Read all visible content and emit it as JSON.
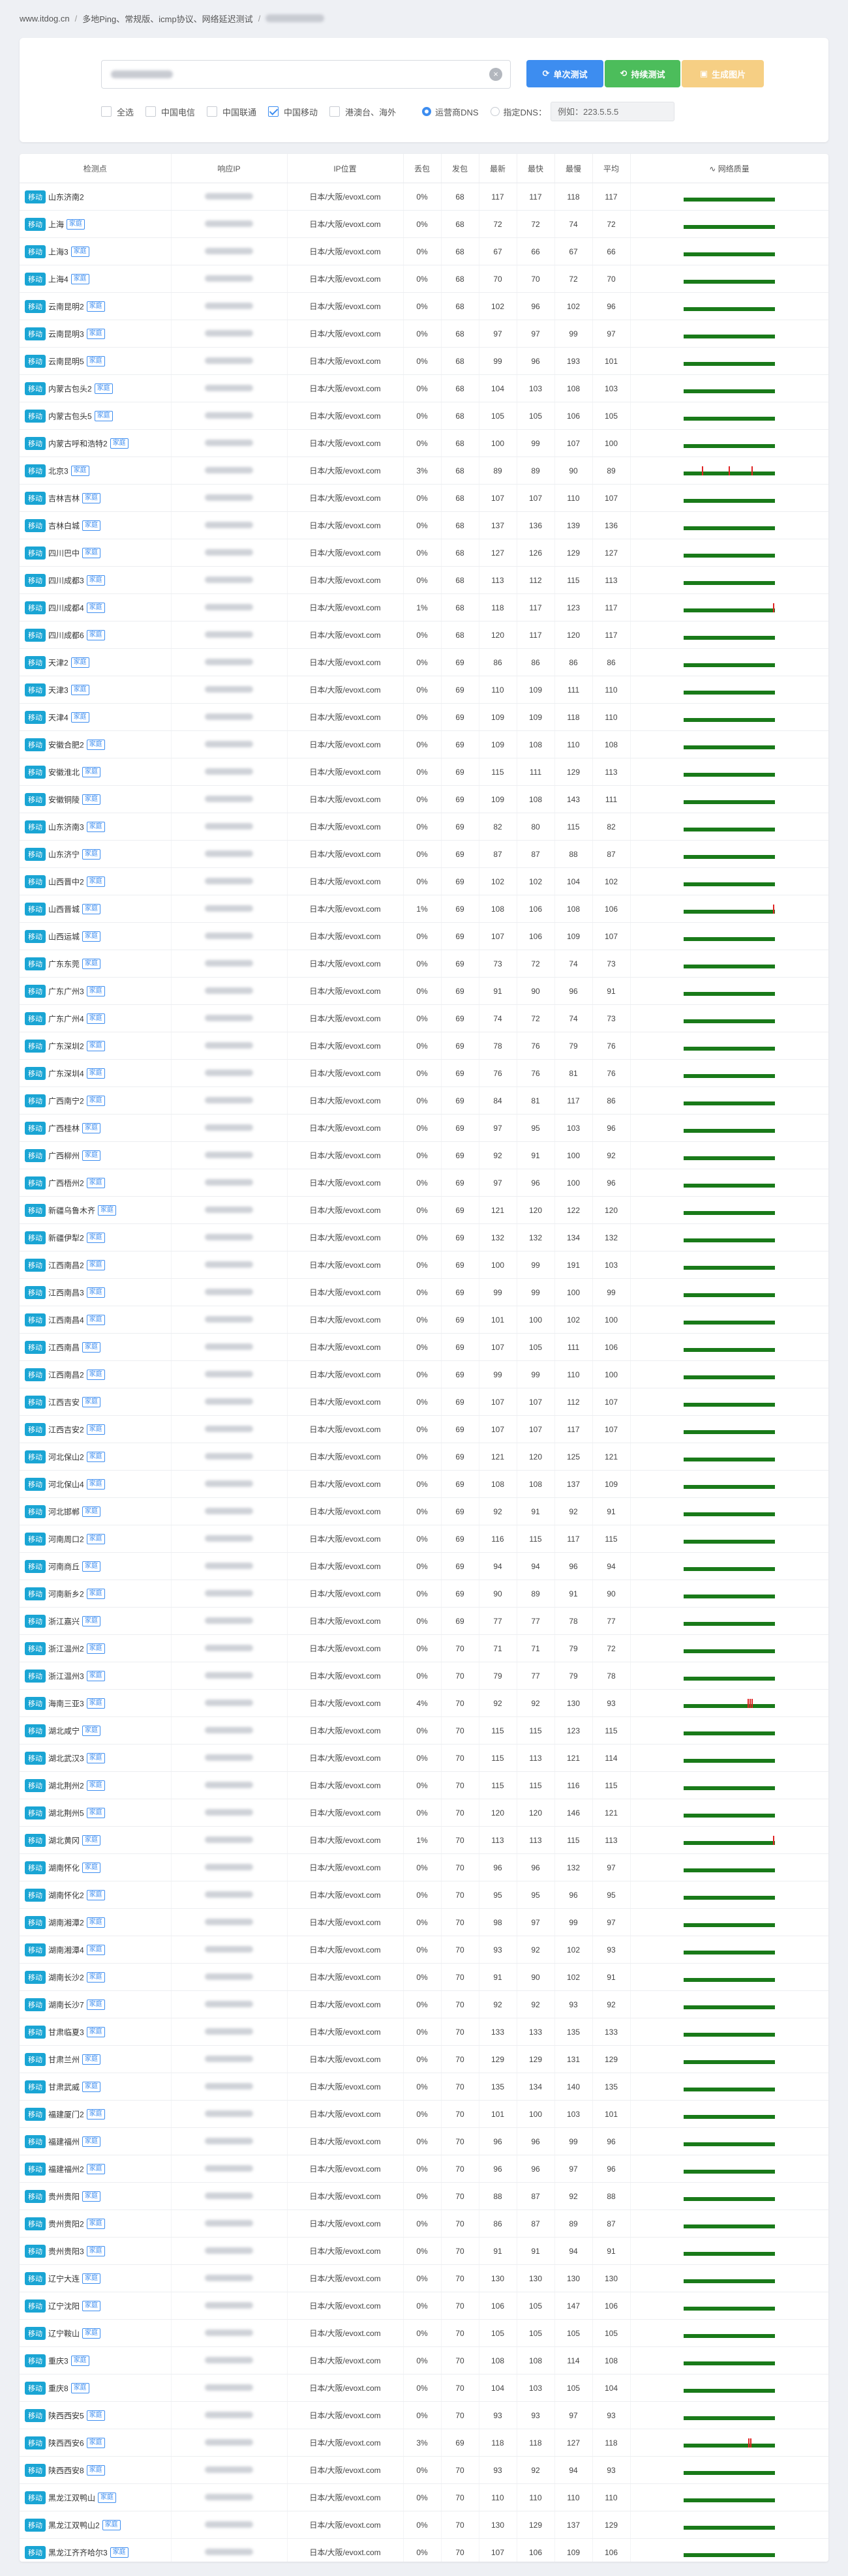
{
  "breadcrumb": {
    "site": "www.itdog.cn",
    "section": "多地Ping、常规版、icmp协议、网络延迟测试"
  },
  "toolbar": {
    "single_test": "单次测试",
    "continuous_test": "持续测试",
    "single_test_icon": "refresh-icon",
    "continuous_test_icon": "loop-icon",
    "generate_icon": "image-icon",
    "generate_label": "生成图片",
    "clear_icon": "×"
  },
  "filters": {
    "all": "全选",
    "telecom": "中国电信",
    "unicom": "中国联通",
    "mobile": "中国移动",
    "hk_tw_overseas": "港澳台、海外",
    "dns_operator": "运营商DNS",
    "dns_custom": "指定DNS：",
    "dns_placeholder": "例如：223.5.5.5"
  },
  "table": {
    "headers": [
      "检测点",
      "响应IP",
      "IP位置",
      "丢包",
      "发包",
      "最新",
      "最快",
      "最慢",
      "平均",
      "网络质量"
    ],
    "quality_icon": "chart-icon",
    "tag": "移动",
    "home_badge": "家庭",
    "location": "日本/大阪/evoxt.com",
    "colors": {
      "good": "#197a19",
      "spike": "#e02424",
      "tag": "#1aa5d4"
    },
    "rows": [
      {
        "name": "山东济南2",
        "h": false,
        "loss": "0%",
        "sent": "68",
        "last": "117",
        "fast": "117",
        "slow": "118",
        "avg": "117",
        "sp": []
      },
      {
        "name": "上海",
        "h": true,
        "loss": "0%",
        "sent": "68",
        "last": "72",
        "fast": "72",
        "slow": "74",
        "avg": "72",
        "sp": []
      },
      {
        "name": "上海3",
        "h": true,
        "loss": "0%",
        "sent": "68",
        "last": "67",
        "fast": "66",
        "slow": "67",
        "avg": "66",
        "sp": []
      },
      {
        "name": "上海4",
        "h": true,
        "loss": "0%",
        "sent": "68",
        "last": "70",
        "fast": "70",
        "slow": "72",
        "avg": "70",
        "sp": []
      },
      {
        "name": "云南昆明2",
        "h": true,
        "loss": "0%",
        "sent": "68",
        "last": "102",
        "fast": "96",
        "slow": "102",
        "avg": "96",
        "sp": []
      },
      {
        "name": "云南昆明3",
        "h": true,
        "loss": "0%",
        "sent": "68",
        "last": "97",
        "fast": "97",
        "slow": "99",
        "avg": "97",
        "sp": []
      },
      {
        "name": "云南昆明5",
        "h": true,
        "loss": "0%",
        "sent": "68",
        "last": "99",
        "fast": "96",
        "slow": "193",
        "avg": "101",
        "sp": []
      },
      {
        "name": "内蒙古包头2",
        "h": true,
        "loss": "0%",
        "sent": "68",
        "last": "104",
        "fast": "103",
        "slow": "108",
        "avg": "103",
        "sp": []
      },
      {
        "name": "内蒙古包头5",
        "h": true,
        "loss": "0%",
        "sent": "68",
        "last": "105",
        "fast": "105",
        "slow": "106",
        "avg": "105",
        "sp": []
      },
      {
        "name": "内蒙古呼和浩特2",
        "h": true,
        "loss": "0%",
        "sent": "68",
        "last": "100",
        "fast": "99",
        "slow": "107",
        "avg": "100",
        "sp": []
      },
      {
        "name": "北京3",
        "h": true,
        "loss": "3%",
        "sent": "68",
        "last": "89",
        "fast": "89",
        "slow": "90",
        "avg": "89",
        "sp": [
          0.2,
          0.5,
          0.75
        ]
      },
      {
        "name": "吉林吉林",
        "h": true,
        "loss": "0%",
        "sent": "68",
        "last": "107",
        "fast": "107",
        "slow": "110",
        "avg": "107",
        "sp": []
      },
      {
        "name": "吉林白城",
        "h": true,
        "loss": "0%",
        "sent": "68",
        "last": "137",
        "fast": "136",
        "slow": "139",
        "avg": "136",
        "sp": []
      },
      {
        "name": "四川巴中",
        "h": true,
        "loss": "0%",
        "sent": "68",
        "last": "127",
        "fast": "126",
        "slow": "129",
        "avg": "127",
        "sp": []
      },
      {
        "name": "四川成都3",
        "h": true,
        "loss": "0%",
        "sent": "68",
        "last": "113",
        "fast": "112",
        "slow": "115",
        "avg": "113",
        "sp": []
      },
      {
        "name": "四川成都4",
        "h": true,
        "loss": "1%",
        "sent": "68",
        "last": "118",
        "fast": "117",
        "slow": "123",
        "avg": "117",
        "sp": [
          0.99
        ]
      },
      {
        "name": "四川成都6",
        "h": true,
        "loss": "0%",
        "sent": "68",
        "last": "120",
        "fast": "117",
        "slow": "120",
        "avg": "117",
        "sp": []
      },
      {
        "name": "天津2",
        "h": true,
        "loss": "0%",
        "sent": "69",
        "last": "86",
        "fast": "86",
        "slow": "86",
        "avg": "86",
        "sp": []
      },
      {
        "name": "天津3",
        "h": true,
        "loss": "0%",
        "sent": "69",
        "last": "110",
        "fast": "109",
        "slow": "111",
        "avg": "110",
        "sp": []
      },
      {
        "name": "天津4",
        "h": true,
        "loss": "0%",
        "sent": "69",
        "last": "109",
        "fast": "109",
        "slow": "118",
        "avg": "110",
        "sp": []
      },
      {
        "name": "安徽合肥2",
        "h": true,
        "loss": "0%",
        "sent": "69",
        "last": "109",
        "fast": "108",
        "slow": "110",
        "avg": "108",
        "sp": []
      },
      {
        "name": "安徽淮北",
        "h": true,
        "loss": "0%",
        "sent": "69",
        "last": "115",
        "fast": "111",
        "slow": "129",
        "avg": "113",
        "sp": []
      },
      {
        "name": "安徽铜陵",
        "h": true,
        "loss": "0%",
        "sent": "69",
        "last": "109",
        "fast": "108",
        "slow": "143",
        "avg": "111",
        "sp": []
      },
      {
        "name": "山东济南3",
        "h": true,
        "loss": "0%",
        "sent": "69",
        "last": "82",
        "fast": "80",
        "slow": "115",
        "avg": "82",
        "sp": []
      },
      {
        "name": "山东济宁",
        "h": true,
        "loss": "0%",
        "sent": "69",
        "last": "87",
        "fast": "87",
        "slow": "88",
        "avg": "87",
        "sp": []
      },
      {
        "name": "山西晋中2",
        "h": true,
        "loss": "0%",
        "sent": "69",
        "last": "102",
        "fast": "102",
        "slow": "104",
        "avg": "102",
        "sp": []
      },
      {
        "name": "山西晋城",
        "h": true,
        "loss": "1%",
        "sent": "69",
        "last": "108",
        "fast": "106",
        "slow": "108",
        "avg": "106",
        "sp": [
          0.99
        ]
      },
      {
        "name": "山西运城",
        "h": true,
        "loss": "0%",
        "sent": "69",
        "last": "107",
        "fast": "106",
        "slow": "109",
        "avg": "107",
        "sp": []
      },
      {
        "name": "广东东莞",
        "h": true,
        "loss": "0%",
        "sent": "69",
        "last": "73",
        "fast": "72",
        "slow": "74",
        "avg": "73",
        "sp": []
      },
      {
        "name": "广东广州3",
        "h": true,
        "loss": "0%",
        "sent": "69",
        "last": "91",
        "fast": "90",
        "slow": "96",
        "avg": "91",
        "sp": []
      },
      {
        "name": "广东广州4",
        "h": true,
        "loss": "0%",
        "sent": "69",
        "last": "74",
        "fast": "72",
        "slow": "74",
        "avg": "73",
        "sp": []
      },
      {
        "name": "广东深圳2",
        "h": true,
        "loss": "0%",
        "sent": "69",
        "last": "78",
        "fast": "76",
        "slow": "79",
        "avg": "76",
        "sp": []
      },
      {
        "name": "广东深圳4",
        "h": true,
        "loss": "0%",
        "sent": "69",
        "last": "76",
        "fast": "76",
        "slow": "81",
        "avg": "76",
        "sp": []
      },
      {
        "name": "广西南宁2",
        "h": true,
        "loss": "0%",
        "sent": "69",
        "last": "84",
        "fast": "81",
        "slow": "117",
        "avg": "86",
        "sp": []
      },
      {
        "name": "广西桂林",
        "h": true,
        "loss": "0%",
        "sent": "69",
        "last": "97",
        "fast": "95",
        "slow": "103",
        "avg": "96",
        "sp": []
      },
      {
        "name": "广西柳州",
        "h": true,
        "loss": "0%",
        "sent": "69",
        "last": "92",
        "fast": "91",
        "slow": "100",
        "avg": "92",
        "sp": []
      },
      {
        "name": "广西梧州2",
        "h": true,
        "loss": "0%",
        "sent": "69",
        "last": "97",
        "fast": "96",
        "slow": "100",
        "avg": "96",
        "sp": []
      },
      {
        "name": "新疆乌鲁木齐",
        "h": true,
        "loss": "0%",
        "sent": "69",
        "last": "121",
        "fast": "120",
        "slow": "122",
        "avg": "120",
        "sp": []
      },
      {
        "name": "新疆伊犁2",
        "h": true,
        "loss": "0%",
        "sent": "69",
        "last": "132",
        "fast": "132",
        "slow": "134",
        "avg": "132",
        "sp": []
      },
      {
        "name": "江西南昌2",
        "h": true,
        "loss": "0%",
        "sent": "69",
        "last": "100",
        "fast": "99",
        "slow": "191",
        "avg": "103",
        "sp": []
      },
      {
        "name": "江西南昌3",
        "h": true,
        "loss": "0%",
        "sent": "69",
        "last": "99",
        "fast": "99",
        "slow": "100",
        "avg": "99",
        "sp": []
      },
      {
        "name": "江西南昌4",
        "h": true,
        "loss": "0%",
        "sent": "69",
        "last": "101",
        "fast": "100",
        "slow": "102",
        "avg": "100",
        "sp": []
      },
      {
        "name": "江西南昌",
        "h": true,
        "loss": "0%",
        "sent": "69",
        "last": "107",
        "fast": "105",
        "slow": "111",
        "avg": "106",
        "sp": []
      },
      {
        "name": "江西南昌2",
        "h": true,
        "loss": "0%",
        "sent": "69",
        "last": "99",
        "fast": "99",
        "slow": "110",
        "avg": "100",
        "sp": []
      },
      {
        "name": "江西吉安",
        "h": true,
        "loss": "0%",
        "sent": "69",
        "last": "107",
        "fast": "107",
        "slow": "112",
        "avg": "107",
        "sp": []
      },
      {
        "name": "江西吉安2",
        "h": true,
        "loss": "0%",
        "sent": "69",
        "last": "107",
        "fast": "107",
        "slow": "117",
        "avg": "107",
        "sp": []
      },
      {
        "name": "河北保山2",
        "h": true,
        "loss": "0%",
        "sent": "69",
        "last": "121",
        "fast": "120",
        "slow": "125",
        "avg": "121",
        "sp": []
      },
      {
        "name": "河北保山4",
        "h": true,
        "loss": "0%",
        "sent": "69",
        "last": "108",
        "fast": "108",
        "slow": "137",
        "avg": "109",
        "sp": []
      },
      {
        "name": "河北邯郸",
        "h": true,
        "loss": "0%",
        "sent": "69",
        "last": "92",
        "fast": "91",
        "slow": "92",
        "avg": "91",
        "sp": []
      },
      {
        "name": "河南周口2",
        "h": true,
        "loss": "0%",
        "sent": "69",
        "last": "116",
        "fast": "115",
        "slow": "117",
        "avg": "115",
        "sp": []
      },
      {
        "name": "河南商丘",
        "h": true,
        "loss": "0%",
        "sent": "69",
        "last": "94",
        "fast": "94",
        "slow": "96",
        "avg": "94",
        "sp": []
      },
      {
        "name": "河南新乡2",
        "h": true,
        "loss": "0%",
        "sent": "69",
        "last": "90",
        "fast": "89",
        "slow": "91",
        "avg": "90",
        "sp": []
      },
      {
        "name": "浙江嘉兴",
        "h": true,
        "loss": "0%",
        "sent": "69",
        "last": "77",
        "fast": "77",
        "slow": "78",
        "avg": "77",
        "sp": []
      },
      {
        "name": "浙江温州2",
        "h": true,
        "loss": "0%",
        "sent": "70",
        "last": "71",
        "fast": "71",
        "slow": "79",
        "avg": "72",
        "sp": []
      },
      {
        "name": "浙江温州3",
        "h": true,
        "loss": "0%",
        "sent": "70",
        "last": "79",
        "fast": "77",
        "slow": "79",
        "avg": "78",
        "sp": []
      },
      {
        "name": "海南三亚3",
        "h": true,
        "loss": "4%",
        "sent": "70",
        "last": "92",
        "fast": "92",
        "slow": "130",
        "avg": "93",
        "sp": [
          0.71,
          0.73,
          0.75
        ]
      },
      {
        "name": "湖北咸宁",
        "h": true,
        "loss": "0%",
        "sent": "70",
        "last": "115",
        "fast": "115",
        "slow": "123",
        "avg": "115",
        "sp": []
      },
      {
        "name": "湖北武汉3",
        "h": true,
        "loss": "0%",
        "sent": "70",
        "last": "115",
        "fast": "113",
        "slow": "121",
        "avg": "114",
        "sp": []
      },
      {
        "name": "湖北荆州2",
        "h": true,
        "loss": "0%",
        "sent": "70",
        "last": "115",
        "fast": "115",
        "slow": "116",
        "avg": "115",
        "sp": []
      },
      {
        "name": "湖北荆州5",
        "h": true,
        "loss": "0%",
        "sent": "70",
        "last": "120",
        "fast": "120",
        "slow": "146",
        "avg": "121",
        "sp": []
      },
      {
        "name": "湖北黄冈",
        "h": true,
        "loss": "1%",
        "sent": "70",
        "last": "113",
        "fast": "113",
        "slow": "115",
        "avg": "113",
        "sp": [
          0.99
        ]
      },
      {
        "name": "湖南怀化",
        "h": true,
        "loss": "0%",
        "sent": "70",
        "last": "96",
        "fast": "96",
        "slow": "132",
        "avg": "97",
        "sp": []
      },
      {
        "name": "湖南怀化2",
        "h": true,
        "loss": "0%",
        "sent": "70",
        "last": "95",
        "fast": "95",
        "slow": "96",
        "avg": "95",
        "sp": []
      },
      {
        "name": "湖南湘潭2",
        "h": true,
        "loss": "0%",
        "sent": "70",
        "last": "98",
        "fast": "97",
        "slow": "99",
        "avg": "97",
        "sp": []
      },
      {
        "name": "湖南湘潭4",
        "h": true,
        "loss": "0%",
        "sent": "70",
        "last": "93",
        "fast": "92",
        "slow": "102",
        "avg": "93",
        "sp": []
      },
      {
        "name": "湖南长沙2",
        "h": true,
        "loss": "0%",
        "sent": "70",
        "last": "91",
        "fast": "90",
        "slow": "102",
        "avg": "91",
        "sp": []
      },
      {
        "name": "湖南长沙7",
        "h": true,
        "loss": "0%",
        "sent": "70",
        "last": "92",
        "fast": "92",
        "slow": "93",
        "avg": "92",
        "sp": []
      },
      {
        "name": "甘肃临夏3",
        "h": true,
        "loss": "0%",
        "sent": "70",
        "last": "133",
        "fast": "133",
        "slow": "135",
        "avg": "133",
        "sp": []
      },
      {
        "name": "甘肃兰州",
        "h": true,
        "loss": "0%",
        "sent": "70",
        "last": "129",
        "fast": "129",
        "slow": "131",
        "avg": "129",
        "sp": []
      },
      {
        "name": "甘肃武威",
        "h": true,
        "loss": "0%",
        "sent": "70",
        "last": "135",
        "fast": "134",
        "slow": "140",
        "avg": "135",
        "sp": []
      },
      {
        "name": "福建厦门2",
        "h": true,
        "loss": "0%",
        "sent": "70",
        "last": "101",
        "fast": "100",
        "slow": "103",
        "avg": "101",
        "sp": []
      },
      {
        "name": "福建福州",
        "h": true,
        "loss": "0%",
        "sent": "70",
        "last": "96",
        "fast": "96",
        "slow": "99",
        "avg": "96",
        "sp": []
      },
      {
        "name": "福建福州2",
        "h": true,
        "loss": "0%",
        "sent": "70",
        "last": "96",
        "fast": "96",
        "slow": "97",
        "avg": "96",
        "sp": []
      },
      {
        "name": "贵州贵阳",
        "h": true,
        "loss": "0%",
        "sent": "70",
        "last": "88",
        "fast": "87",
        "slow": "92",
        "avg": "88",
        "sp": []
      },
      {
        "name": "贵州贵阳2",
        "h": true,
        "loss": "0%",
        "sent": "70",
        "last": "86",
        "fast": "87",
        "slow": "89",
        "avg": "87",
        "sp": []
      },
      {
        "name": "贵州贵阳3",
        "h": true,
        "loss": "0%",
        "sent": "70",
        "last": "91",
        "fast": "91",
        "slow": "94",
        "avg": "91",
        "sp": []
      },
      {
        "name": "辽宁大连",
        "h": true,
        "loss": "0%",
        "sent": "70",
        "last": "130",
        "fast": "130",
        "slow": "130",
        "avg": "130",
        "sp": []
      },
      {
        "name": "辽宁沈阳",
        "h": true,
        "loss": "0%",
        "sent": "70",
        "last": "106",
        "fast": "105",
        "slow": "147",
        "avg": "106",
        "sp": []
      },
      {
        "name": "辽宁鞍山",
        "h": true,
        "loss": "0%",
        "sent": "70",
        "last": "105",
        "fast": "105",
        "slow": "105",
        "avg": "105",
        "sp": []
      },
      {
        "name": "重庆3",
        "h": true,
        "loss": "0%",
        "sent": "70",
        "last": "108",
        "fast": "108",
        "slow": "114",
        "avg": "108",
        "sp": []
      },
      {
        "name": "重庆8",
        "h": true,
        "loss": "0%",
        "sent": "70",
        "last": "104",
        "fast": "103",
        "slow": "105",
        "avg": "104",
        "sp": []
      },
      {
        "name": "陕西西安5",
        "h": true,
        "loss": "0%",
        "sent": "70",
        "last": "93",
        "fast": "93",
        "slow": "97",
        "avg": "93",
        "sp": []
      },
      {
        "name": "陕西西安6",
        "h": true,
        "loss": "3%",
        "sent": "69",
        "last": "118",
        "fast": "118",
        "slow": "127",
        "avg": "118",
        "sp": [
          0.72,
          0.74
        ]
      },
      {
        "name": "陕西西安8",
        "h": true,
        "loss": "0%",
        "sent": "70",
        "last": "93",
        "fast": "92",
        "slow": "94",
        "avg": "93",
        "sp": []
      },
      {
        "name": "黑龙江双鸭山",
        "h": true,
        "loss": "0%",
        "sent": "70",
        "last": "110",
        "fast": "110",
        "slow": "110",
        "avg": "110",
        "sp": []
      },
      {
        "name": "黑龙江双鸭山2",
        "h": true,
        "loss": "0%",
        "sent": "70",
        "last": "130",
        "fast": "129",
        "slow": "137",
        "avg": "129",
        "sp": []
      },
      {
        "name": "黑龙江齐齐哈尔3",
        "h": true,
        "loss": "0%",
        "sent": "70",
        "last": "107",
        "fast": "106",
        "slow": "109",
        "avg": "106",
        "sp": []
      }
    ]
  }
}
